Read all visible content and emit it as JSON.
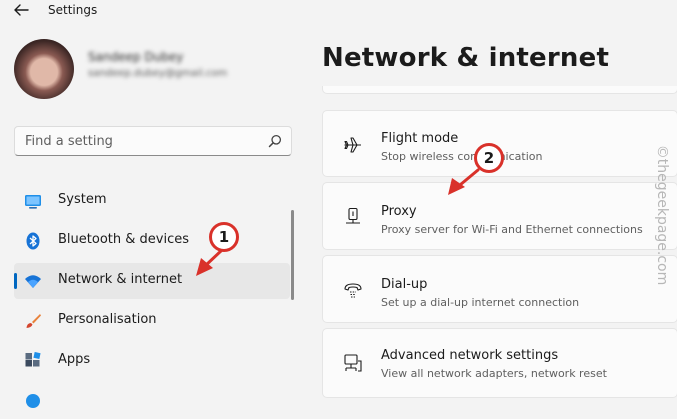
{
  "window": {
    "title": "Settings"
  },
  "user": {
    "name": "Sandeep Dubey",
    "email": "sandeep.dubey@gmail.com"
  },
  "search": {
    "placeholder": "Find a setting"
  },
  "sidebar": {
    "items": [
      {
        "label": "System",
        "icon": "system-monitor-icon",
        "active": false
      },
      {
        "label": "Bluetooth & devices",
        "icon": "bluetooth-icon",
        "active": false
      },
      {
        "label": "Network & internet",
        "icon": "wifi-icon",
        "active": true
      },
      {
        "label": "Personalisation",
        "icon": "paintbrush-icon",
        "active": false
      },
      {
        "label": "Apps",
        "icon": "apps-grid-icon",
        "active": false
      }
    ]
  },
  "main": {
    "title": "Network & internet",
    "cards": [
      {
        "title": "Flight mode",
        "desc": "Stop wireless communication",
        "icon": "airplane-icon"
      },
      {
        "title": "Proxy",
        "desc": "Proxy server for Wi-Fi and Ethernet connections",
        "icon": "proxy-icon"
      },
      {
        "title": "Dial-up",
        "desc": "Set up a dial-up internet connection",
        "icon": "dialup-icon"
      },
      {
        "title": "Advanced network settings",
        "desc": "View all network adapters, network reset",
        "icon": "network-adapters-icon"
      }
    ]
  },
  "annotations": {
    "step1": "1",
    "step2": "2",
    "color": "#d9312a"
  },
  "watermark": "©thegeekpage.com",
  "colors": {
    "accent": "#0067c0",
    "background": "#f3f3f3",
    "card": "#fbfbfb"
  }
}
